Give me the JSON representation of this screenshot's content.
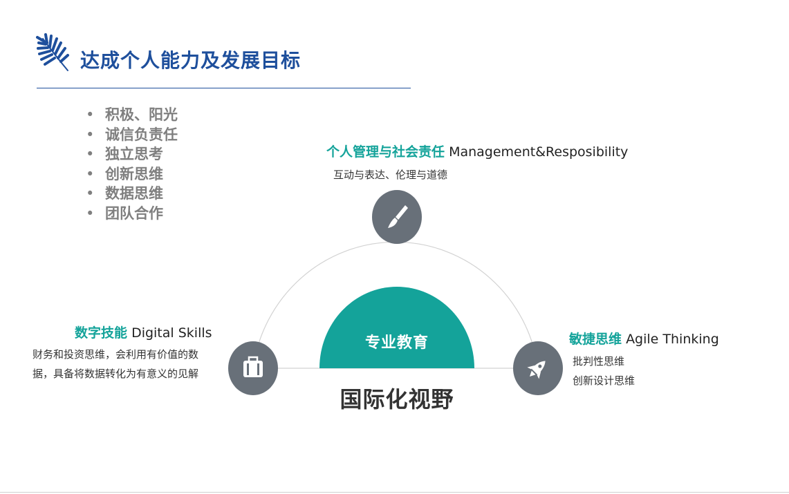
{
  "slide": {
    "title": "达成个人能力及发展目标",
    "accent_color": "#14a39a",
    "title_color": "#1e4f9c",
    "icon_circle_color": "#687079"
  },
  "bullets": [
    "积极、阳光",
    "诚信负责任",
    "独立思考",
    "创新思维",
    "数据思维",
    "团队合作"
  ],
  "diagram": {
    "center_label": "专业教育",
    "bottom_label": "国际化视野",
    "top": {
      "title_zh": "个人管理与社会责任",
      "title_en": "Management&Resposibility",
      "desc": "互动与表达、伦理与道德",
      "icon": "brush-icon"
    },
    "left": {
      "title_zh": "数字技能",
      "title_en": "Digital Skills",
      "desc_lines": [
        "财务和投资思维，会利用有价值的数",
        "据，具备将数据转化为有意义的见解"
      ],
      "icon": "briefcase-icon"
    },
    "right": {
      "title_zh": "敏捷思维",
      "title_en": "Agile Thinking",
      "desc_lines": [
        "批判性思维",
        "创新设计思维"
      ],
      "icon": "rocket-icon"
    }
  }
}
